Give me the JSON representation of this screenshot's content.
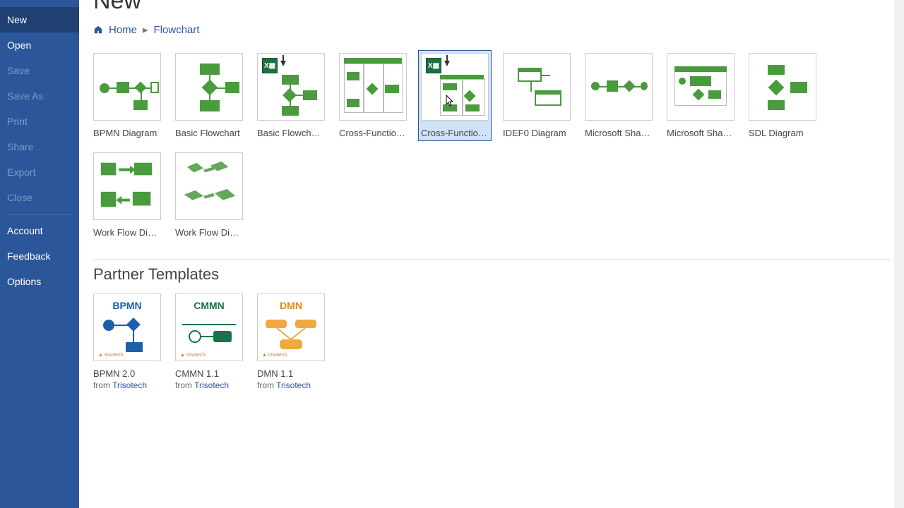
{
  "sidebar": {
    "items": [
      {
        "label": "New",
        "selected": true,
        "disabled": false
      },
      {
        "label": "Open",
        "selected": false,
        "disabled": false
      },
      {
        "label": "Save",
        "selected": false,
        "disabled": true
      },
      {
        "label": "Save As",
        "selected": false,
        "disabled": true
      },
      {
        "label": "Print",
        "selected": false,
        "disabled": true
      },
      {
        "label": "Share",
        "selected": false,
        "disabled": true
      },
      {
        "label": "Export",
        "selected": false,
        "disabled": true
      },
      {
        "label": "Close",
        "selected": false,
        "disabled": true
      }
    ],
    "footer": [
      {
        "label": "Account"
      },
      {
        "label": "Feedback"
      },
      {
        "label": "Options"
      }
    ]
  },
  "page": {
    "title": "New",
    "breadcrumb": {
      "home": "Home",
      "current": "Flowchart"
    },
    "partner_section": "Partner Templates"
  },
  "templates": [
    {
      "label": "BPMN Diagram"
    },
    {
      "label": "Basic Flowchart"
    },
    {
      "label": "Basic Flowchart..."
    },
    {
      "label": "Cross-Functional..."
    },
    {
      "label": "Cross-Functional...",
      "selected": true
    },
    {
      "label": "IDEF0 Diagram"
    },
    {
      "label": "Microsoft Share..."
    },
    {
      "label": "Microsoft Share..."
    },
    {
      "label": "SDL Diagram"
    },
    {
      "label": "Work Flow Diagr..."
    },
    {
      "label": "Work Flow Diagr..."
    }
  ],
  "partners": [
    {
      "title": "BPMN",
      "label": "BPMN 2.0",
      "from": "from ",
      "vendor": "Trisotech"
    },
    {
      "title": "CMMN",
      "label": "CMMN 1.1",
      "from": "from ",
      "vendor": "Trisotech"
    },
    {
      "title": "DMN",
      "label": "DMN 1.1",
      "from": "from ",
      "vendor": "Trisotech"
    }
  ]
}
